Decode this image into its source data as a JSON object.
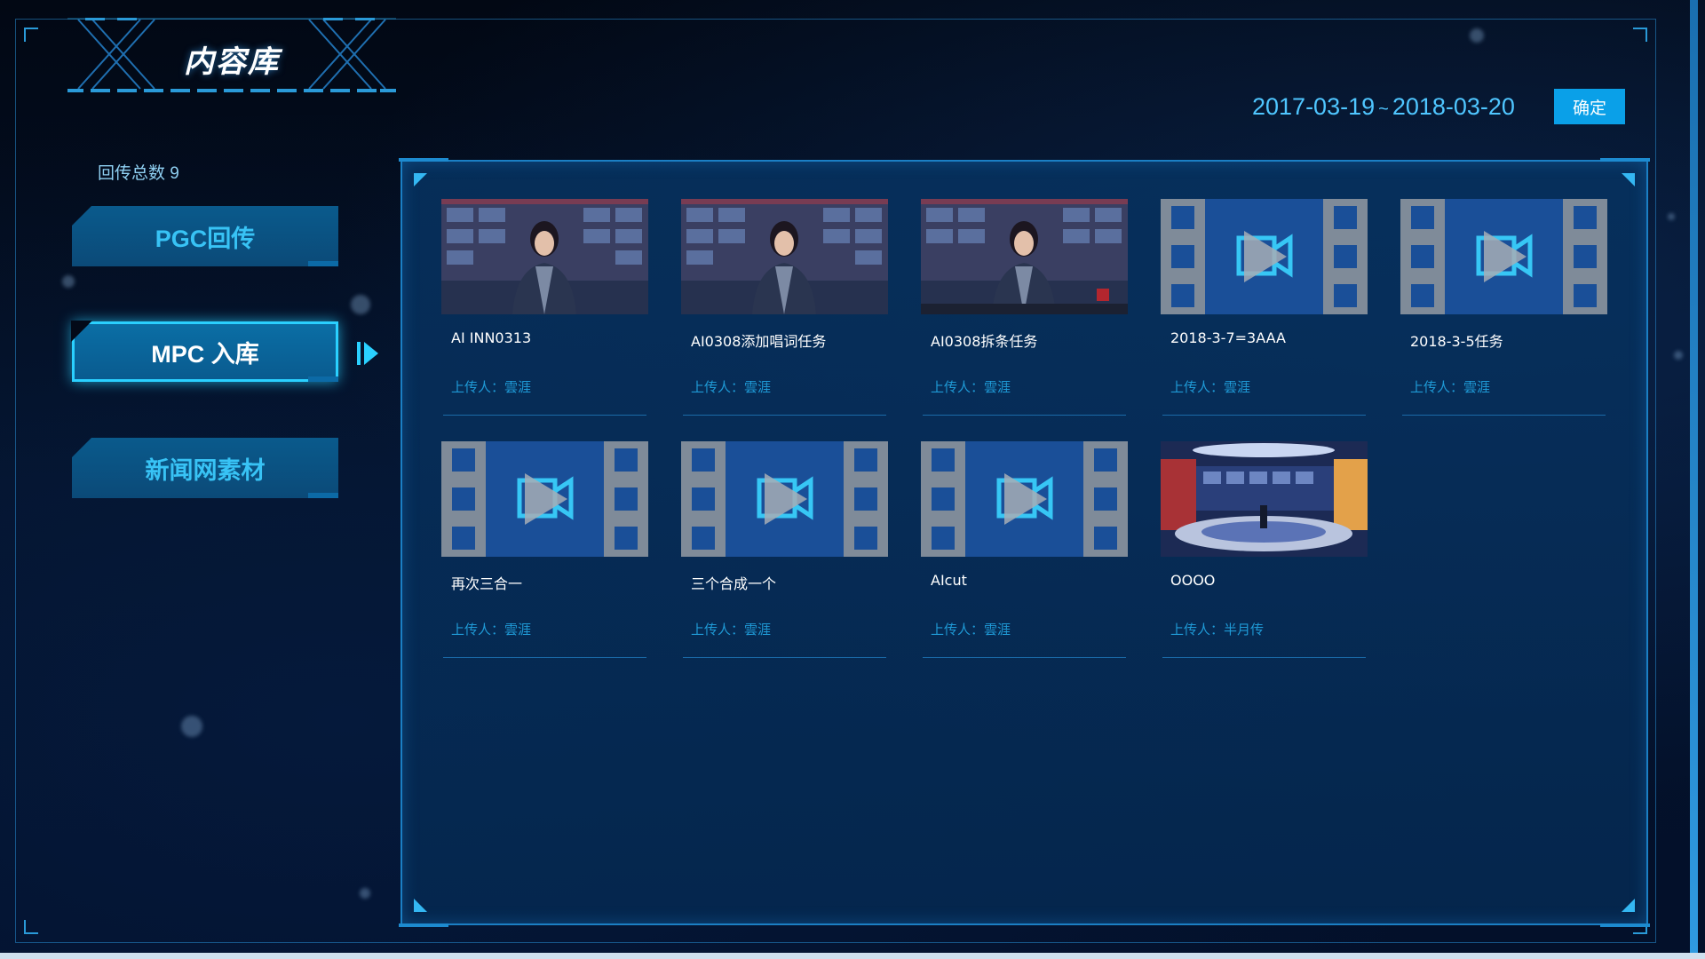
{
  "header": {
    "title": "内容库",
    "date_start": "2017-03-19",
    "date_separator": "~",
    "date_end": "2018-03-20",
    "confirm_label": "确定"
  },
  "sidebar": {
    "total_label": "回传总数 9",
    "nav": [
      {
        "label": "PGC回传",
        "active": false
      },
      {
        "label": "MPC 入库",
        "active": true
      },
      {
        "label": "新闻网素材",
        "active": false
      }
    ]
  },
  "items": [
    {
      "title": "AI INN0313",
      "uploader": "上传人：雲涯",
      "thumb": "anchor-image"
    },
    {
      "title": "AI0308添加唱词任务",
      "uploader": "上传人：雲涯",
      "thumb": "anchor-image"
    },
    {
      "title": "AI0308拆条任务",
      "uploader": "上传人：雲涯",
      "thumb": "anchor-image-ticker"
    },
    {
      "title": "2018-3-7=3AAA",
      "uploader": "上传人：雲涯",
      "thumb": "video-placeholder-icon"
    },
    {
      "title": "2018-3-5任务",
      "uploader": "上传人：雲涯",
      "thumb": "video-placeholder-icon"
    },
    {
      "title": "再次三合一",
      "uploader": "上传人：雲涯",
      "thumb": "video-placeholder-icon"
    },
    {
      "title": "三个合成一个",
      "uploader": "上传人：雲涯",
      "thumb": "video-placeholder-icon"
    },
    {
      "title": "AIcut",
      "uploader": "上传人：雲涯",
      "thumb": "video-placeholder-icon"
    },
    {
      "title": "OOOO",
      "uploader": "上传人：半月传",
      "thumb": "studio-image"
    }
  ],
  "colors": {
    "accent": "#2ad0ff",
    "confirm_bg": "#0aa0e8",
    "uploader_text": "#1f9ad6",
    "date_text": "#4fc6ff"
  }
}
